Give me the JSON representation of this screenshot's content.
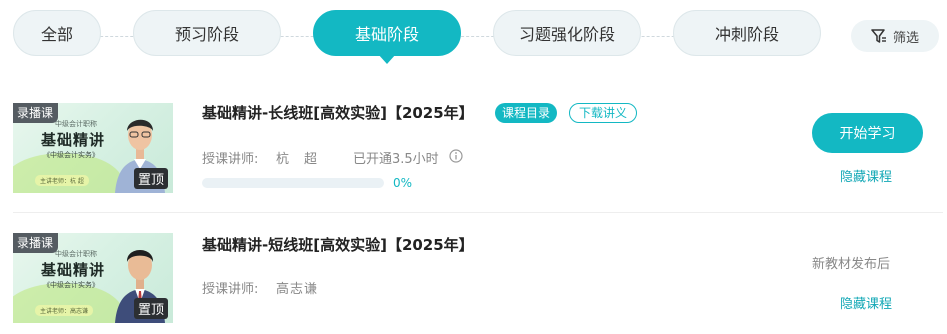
{
  "stage_tabs": [
    {
      "label": "全部"
    },
    {
      "label": "预习阶段"
    },
    {
      "label": "基础阶段"
    },
    {
      "label": "习题强化阶段"
    },
    {
      "label": "冲刺阶段"
    }
  ],
  "active_stage": "基础阶段",
  "filter": {
    "label": "筛选",
    "icon": "filter-icon"
  },
  "accent_color": "#13b8c3",
  "courses": [
    {
      "thumb": {
        "tag": "录播课",
        "subtitle": "中级会计职称",
        "headline": "基础精讲",
        "book": "《中级会计实务》",
        "teacher_line": "主讲老师：杭 超",
        "pin": "置顶"
      },
      "title": "基础精讲-长线班[高效实验]【2025年】",
      "badge_catalog": "课程目录",
      "badge_handout": "下载讲义",
      "teacher_label": "授课讲师:",
      "teacher_name": "杭　超",
      "opened": "已开通3.5小时",
      "progress": 0,
      "progress_text": "0%",
      "start_label": "开始学习",
      "hide_label": "隐藏课程"
    },
    {
      "thumb": {
        "tag": "录播课",
        "subtitle": "中级会计职称",
        "headline": "基础精讲",
        "book": "《中级会计实务》",
        "teacher_line": "主讲老师：高志谦",
        "pin": "置顶"
      },
      "title": "基础精讲-短线班[高效实验]【2025年】",
      "teacher_label": "授课讲师:",
      "teacher_name": "高志谦",
      "pending_text": "新教材发布后",
      "hide_label": "隐藏课程"
    }
  ]
}
